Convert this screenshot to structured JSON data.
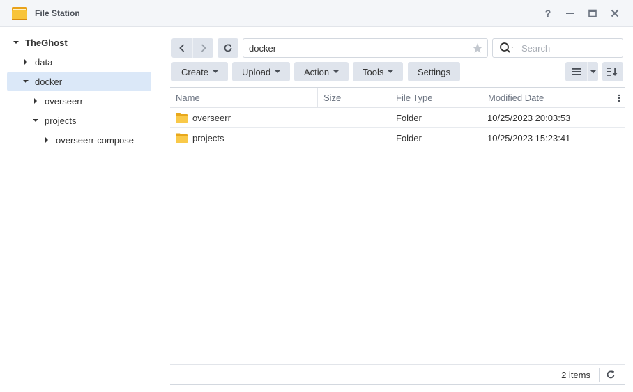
{
  "window": {
    "title": "File Station",
    "controls": [
      "help-icon",
      "minimize-icon",
      "maximize-icon",
      "close-icon"
    ]
  },
  "sidebar": {
    "root": {
      "label": "TheGhost",
      "expanded": true
    },
    "items": [
      {
        "label": "data",
        "expanded": false,
        "depth": 1
      },
      {
        "label": "docker",
        "expanded": true,
        "depth": 1,
        "selected": true
      },
      {
        "label": "overseerr",
        "expanded": false,
        "depth": 2
      },
      {
        "label": "projects",
        "expanded": true,
        "depth": 2
      },
      {
        "label": "overseerr-compose",
        "expanded": false,
        "depth": 3
      }
    ]
  },
  "toolbar": {
    "path": "docker",
    "search_placeholder": "Search",
    "create_label": "Create",
    "upload_label": "Upload",
    "action_label": "Action",
    "tools_label": "Tools",
    "settings_label": "Settings"
  },
  "grid": {
    "columns": [
      "Name",
      "Size",
      "File Type",
      "Modified Date"
    ],
    "rows": [
      {
        "name": "overseerr",
        "size": "",
        "type": "Folder",
        "modified": "10/25/2023 20:03:53"
      },
      {
        "name": "projects",
        "size": "",
        "type": "Folder",
        "modified": "10/25/2023 15:23:41"
      }
    ]
  },
  "footer": {
    "item_count": "2 items"
  },
  "colors": {
    "selected_row": "#dbe8f8",
    "button_bg": "#dfe4ec",
    "folder": "#f9c949"
  }
}
